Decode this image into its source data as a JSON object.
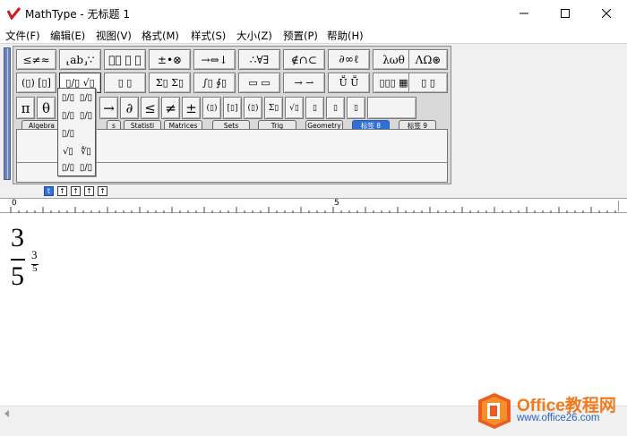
{
  "window": {
    "title": "MathType - 无标题 1"
  },
  "menu": [
    "文件(F)",
    "编辑(E)",
    "视图(V)",
    "格式(M)",
    "样式(S)",
    "大小(Z)",
    "预置(P)",
    "帮助(H)"
  ],
  "toolbar": {
    "row1": [
      "≤≠≈",
      "⸤ab⸥∵",
      "⸱⃗ ⃗ ⃗",
      "±•⊗",
      "→⇔↓",
      "∴∀∃",
      "∉∩⊂",
      "∂∞ℓ",
      "λωθ",
      "ΛΩ⊛"
    ],
    "row2": [
      "(▯) [▯]",
      "▯/▯ √▯",
      "▯ ▯",
      "Σ▯ Σ▯",
      "∫▯ ∮▯",
      "▭ ▭",
      "→ ⇀",
      "Ṻ Ṻ",
      "▯▯▯ ▦",
      "▯ ▯"
    ],
    "row3": [
      "π",
      "θ",
      "→",
      "∂",
      "≤",
      "≠",
      "±",
      "(▯)",
      "[▯]",
      "(▯)",
      "Σ▯",
      "√▯",
      "▯",
      "▯",
      "▯"
    ],
    "tabs": [
      "Algebra",
      "s",
      "Statisti",
      "Matrices",
      "Sets",
      "Trig",
      "Geometry",
      "标签 8",
      "标签 9"
    ],
    "active_tab": "标签 8",
    "dropdown": [
      "▯/▯",
      "▯/▯",
      "▯/▯",
      "▯/▯",
      "√▯",
      "∜▯",
      "▯/▯",
      "▯/▯"
    ]
  },
  "size_buttons": [
    "t",
    "↑",
    "↑",
    "↑",
    "↑"
  ],
  "ruler": {
    "labels": [
      "0",
      "5"
    ]
  },
  "editor": {
    "equation": {
      "big_num": "3",
      "big_den": "5",
      "small_num": "3",
      "small_den": "5"
    }
  },
  "watermark": {
    "title": "Office教程网",
    "url": "www.office26.com"
  }
}
